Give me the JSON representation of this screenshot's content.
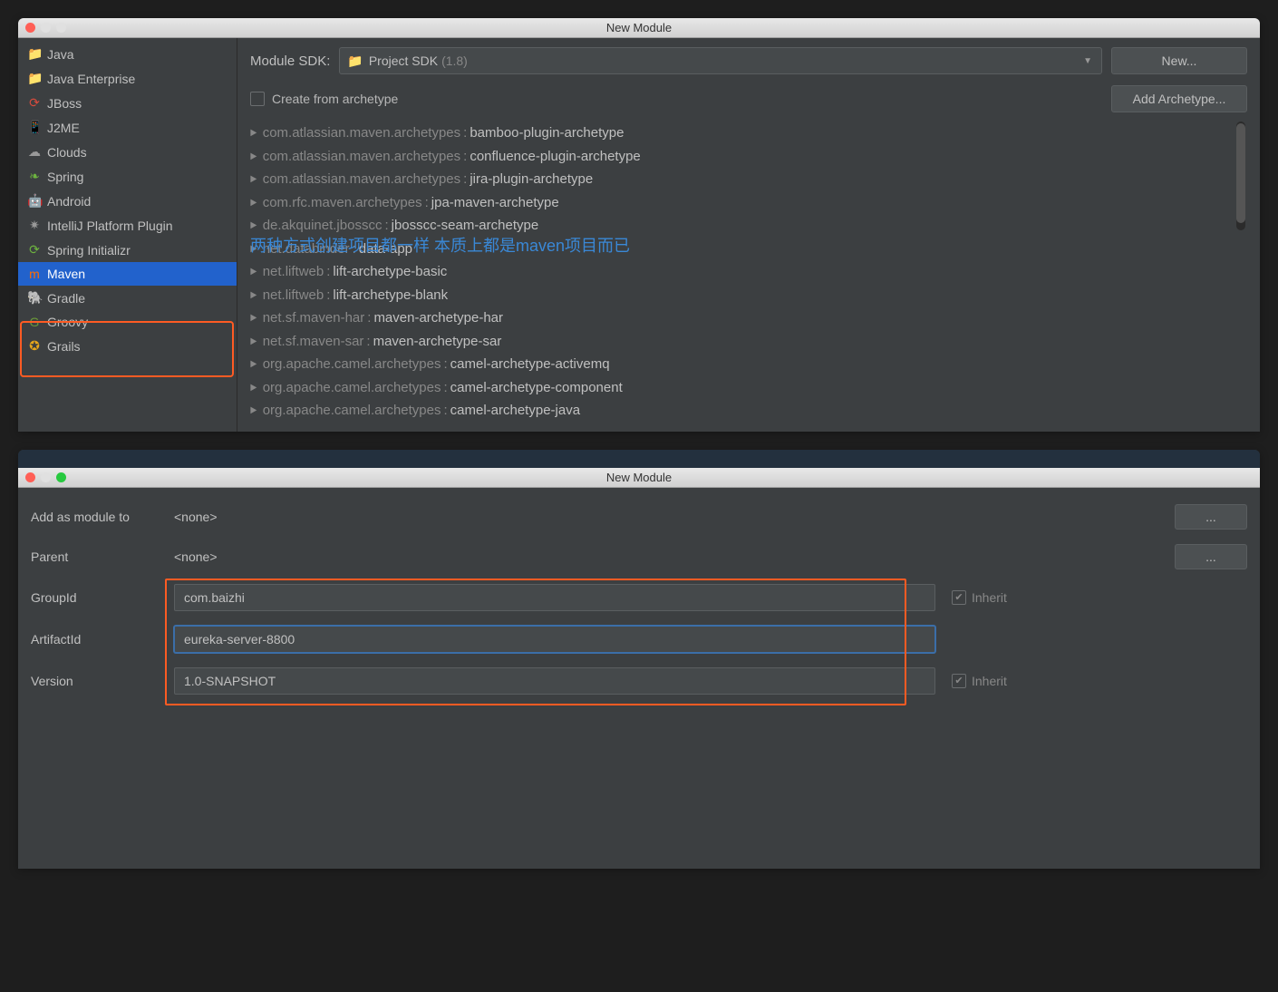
{
  "window1": {
    "title": "New Module",
    "sdk_label": "Module SDK:",
    "sdk_value": "Project SDK",
    "sdk_version": "(1.8)",
    "new_button": "New...",
    "create_from_archetype": "Create from archetype",
    "add_archetype_button": "Add Archetype..."
  },
  "sidebar": [
    {
      "icon": "📁",
      "label": "Java",
      "icon_color": "#4a9ddb"
    },
    {
      "icon": "📁",
      "label": "Java Enterprise",
      "icon_color": "#4a9ddb"
    },
    {
      "icon": "⟳",
      "label": "JBoss",
      "icon_color": "#d54b3d"
    },
    {
      "icon": "📱",
      "label": "J2ME",
      "icon_color": "#4a9ddb"
    },
    {
      "icon": "☁",
      "label": "Clouds",
      "icon_color": "#999"
    },
    {
      "icon": "❧",
      "label": "Spring",
      "icon_color": "#6db33f"
    },
    {
      "icon": "🤖",
      "label": "Android",
      "icon_color": "#a4c639"
    },
    {
      "icon": "✷",
      "label": "IntelliJ Platform Plugin",
      "icon_color": "#999"
    },
    {
      "icon": "⟳",
      "label": "Spring Initializr",
      "icon_color": "#6db33f"
    },
    {
      "icon": "m",
      "label": "Maven",
      "icon_color": "#ff6a00",
      "selected": true
    },
    {
      "icon": "🐘",
      "label": "Gradle",
      "icon_color": "#888"
    },
    {
      "icon": "G",
      "label": "Groovy",
      "icon_color": "#6b9939"
    },
    {
      "icon": "✪",
      "label": "Grails",
      "icon_color": "#e7a61a"
    }
  ],
  "archetypes": [
    {
      "prefix": "com.atlassian.maven.archetypes",
      "name": "bamboo-plugin-archetype"
    },
    {
      "prefix": "com.atlassian.maven.archetypes",
      "name": "confluence-plugin-archetype"
    },
    {
      "prefix": "com.atlassian.maven.archetypes",
      "name": "jira-plugin-archetype"
    },
    {
      "prefix": "com.rfc.maven.archetypes",
      "name": "jpa-maven-archetype"
    },
    {
      "prefix": "de.akquinet.jbosscc",
      "name": "jbosscc-seam-archetype"
    },
    {
      "prefix": "net.databinder",
      "name": "data-app"
    },
    {
      "prefix": "net.liftweb",
      "name": "lift-archetype-basic"
    },
    {
      "prefix": "net.liftweb",
      "name": "lift-archetype-blank"
    },
    {
      "prefix": "net.sf.maven-har",
      "name": "maven-archetype-har"
    },
    {
      "prefix": "net.sf.maven-sar",
      "name": "maven-archetype-sar"
    },
    {
      "prefix": "org.apache.camel.archetypes",
      "name": "camel-archetype-activemq"
    },
    {
      "prefix": "org.apache.camel.archetypes",
      "name": "camel-archetype-component"
    },
    {
      "prefix": "org.apache.camel.archetypes",
      "name": "camel-archetype-java"
    }
  ],
  "overlay": "两种方式创建项目都一样  本质上都是maven项目而已",
  "window2": {
    "title": "New Module",
    "add_module_label": "Add as module to",
    "add_module_value": "<none>",
    "parent_label": "Parent",
    "parent_value": "<none>",
    "groupid_label": "GroupId",
    "groupid_value": "com.baizhi",
    "artifactid_label": "ArtifactId",
    "artifactid_value": "eureka-server-8800",
    "version_label": "Version",
    "version_value": "1.0-SNAPSHOT",
    "inherit_label": "Inherit",
    "browse_button": "..."
  }
}
